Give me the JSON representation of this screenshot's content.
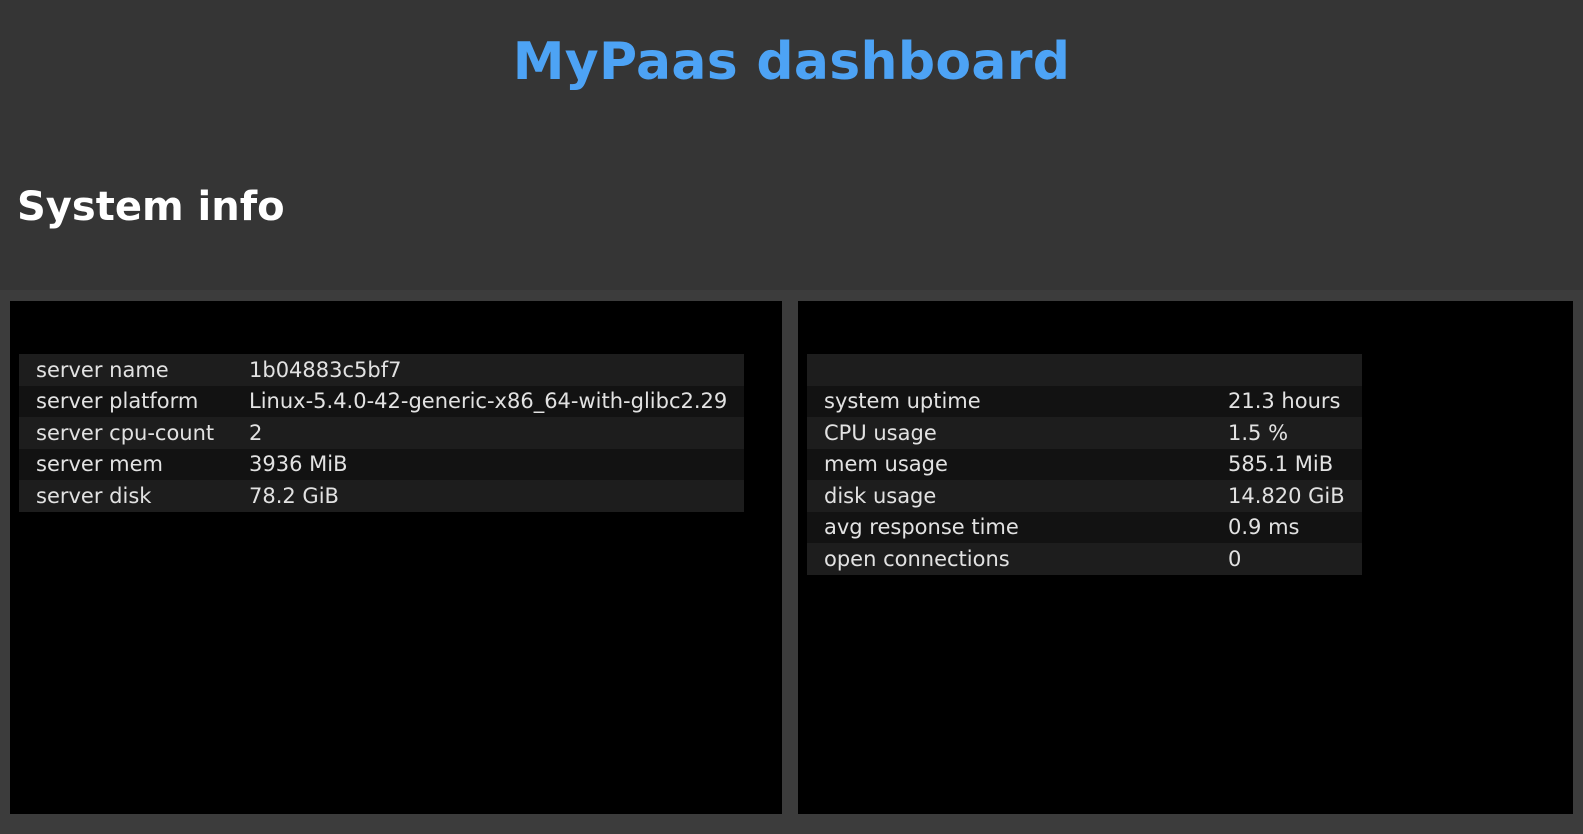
{
  "header": {
    "title": "MyPaas dashboard",
    "section_title": "System info"
  },
  "server_info": [
    {
      "key": "server name",
      "value": "1b04883c5bf7"
    },
    {
      "key": "server platform",
      "value": "Linux-5.4.0-42-generic-x86_64-with-glibc2.29"
    },
    {
      "key": "server cpu-count",
      "value": "2"
    },
    {
      "key": "server mem",
      "value": "3936 MiB"
    },
    {
      "key": "server disk",
      "value": "78.2 GiB"
    }
  ],
  "system_stats": [
    {
      "key": "system uptime",
      "value": "21.3 hours"
    },
    {
      "key": "CPU usage",
      "value": "1.5 %"
    },
    {
      "key": "mem usage",
      "value": "585.1 MiB"
    },
    {
      "key": "disk usage",
      "value": "14.820 GiB"
    },
    {
      "key": "avg response time",
      "value": "0.9 ms"
    },
    {
      "key": "open connections",
      "value": "0"
    }
  ],
  "colors": {
    "title": "#4da3f5",
    "background": "#353535",
    "panel": "#000000"
  }
}
